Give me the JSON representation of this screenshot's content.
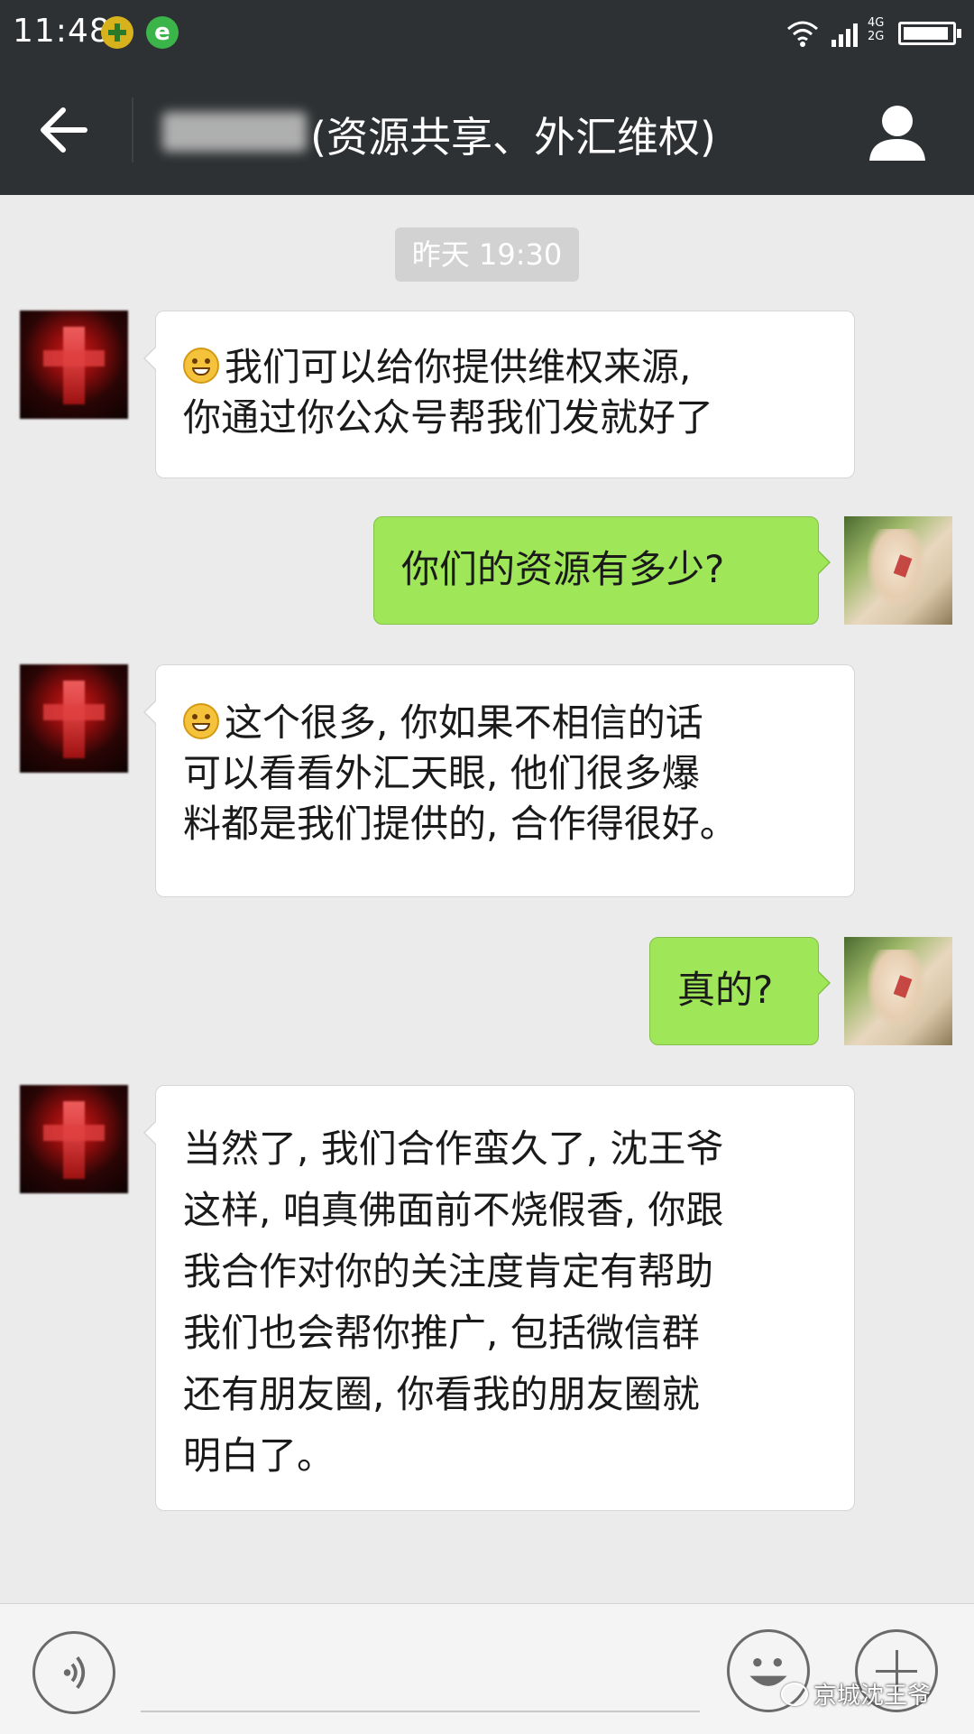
{
  "status_bar": {
    "time": "11:48",
    "network_labels": [
      "4G",
      "2G"
    ],
    "battery_level": 0.95,
    "icons": [
      "app-plus-icon",
      "browser-e-icon",
      "wifi-icon",
      "signal-icon",
      "battery-icon"
    ]
  },
  "header": {
    "title": "(资源共享、外汇维权)",
    "title_prefix_obscured": true,
    "icons": [
      "back-arrow-icon",
      "profile-icon"
    ]
  },
  "chat": {
    "timestamp": "昨天 19:30",
    "messages": [
      {
        "side": "left",
        "emoji": "grin-emoji",
        "lines": [
          "我们可以给你提供维权来源,",
          "你通过你公众号帮我们发就好了"
        ]
      },
      {
        "side": "right",
        "lines": [
          "你们的资源有多少?"
        ]
      },
      {
        "side": "left",
        "emoji": "laugh-emoji",
        "lines": [
          "这个很多, 你如果不相信的话",
          "可以看看外汇天眼, 他们很多爆",
          "料都是我们提供的, 合作得很好。"
        ]
      },
      {
        "side": "right",
        "lines": [
          "真的?"
        ]
      },
      {
        "side": "left",
        "lines": [
          "当然了, 我们合作蛮久了, 沈王爷",
          "这样, 咱真佛面前不烧假香, 你跟",
          "我合作对你的关注度肯定有帮助",
          "我们也会帮你推广, 包括微信群",
          "还有朋友圈, 你看我的朋友圈就",
          "明白了。"
        ]
      }
    ]
  },
  "input_bar": {
    "icons": [
      "voice-icon",
      "emoji-face-icon",
      "plus-icon"
    ]
  },
  "watermark": {
    "text": "京城沈王爷"
  },
  "colors": {
    "header_bg": "#2e3133",
    "chat_bg": "#ebebeb",
    "bubble_self": "#9fe658",
    "bubble_other": "#ffffff"
  }
}
